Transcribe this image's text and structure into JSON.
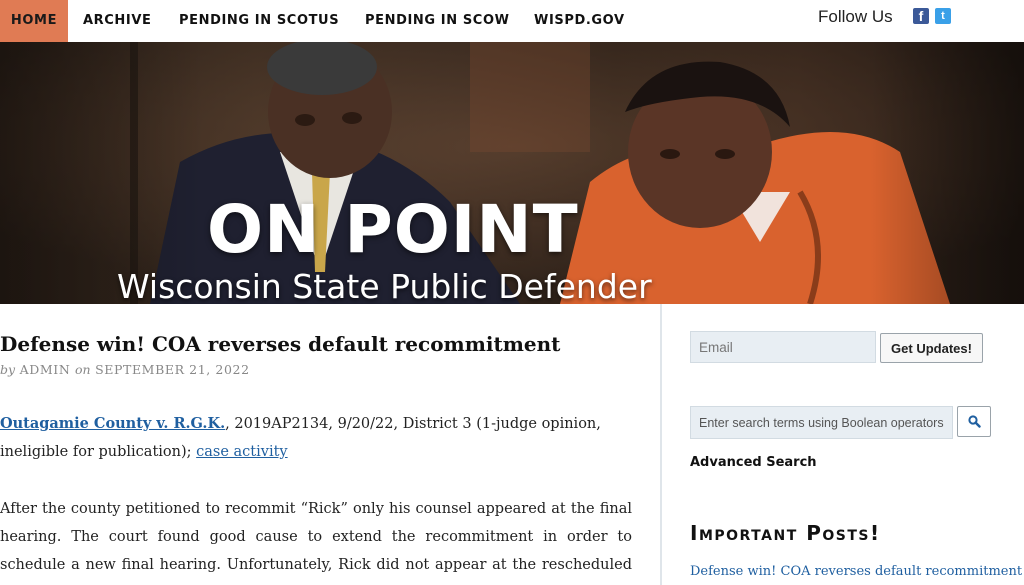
{
  "nav": {
    "home": "HOME",
    "archive": "ARCHIVE",
    "pending_scotus": "PENDING IN SCOTUS",
    "pending_scow": "PENDING IN SCOW",
    "wispd": "WISPD.GOV",
    "active_color": "#e07b54"
  },
  "social": {
    "follow_label": "Follow Us",
    "facebook_icon": "facebook-icon",
    "twitter_icon": "twitter-icon"
  },
  "hero": {
    "title": "ON POINT",
    "subtitle": "Wisconsin State Public Defender"
  },
  "article": {
    "title": "Defense win! COA reverses default recommitment",
    "byline_prefix": "by",
    "author": "ADMIN",
    "byline_on": "on",
    "date": "SEPTEMBER 21, 2022",
    "case_name": "Outagamie County v. R.G.K.",
    "case_details_1": ", 2019AP2134, 9/20/22, District 3 (1-judge opinion,",
    "case_details_2": "ineligible for publication);",
    "case_activity_link": "case activity",
    "para2_line1": "After the county petitioned to recommit “Rick” only his counsel appeared at the final",
    "para2_line2": "hearing. The court found good cause to extend the recommitment in order to",
    "para2_line3": "schedule a new final hearing. Unfortunately, Rick did not appear at the rescheduled"
  },
  "sidebar": {
    "email_placeholder": "Email",
    "get_updates": "Get Updates!",
    "search_placeholder": "Enter search terms using Boolean operators",
    "advanced_search": "Advanced Search",
    "important_posts": "Important Posts!",
    "recent_post": "Defense win! COA reverses default recommitment",
    "link_color": "#1f5fa0"
  }
}
